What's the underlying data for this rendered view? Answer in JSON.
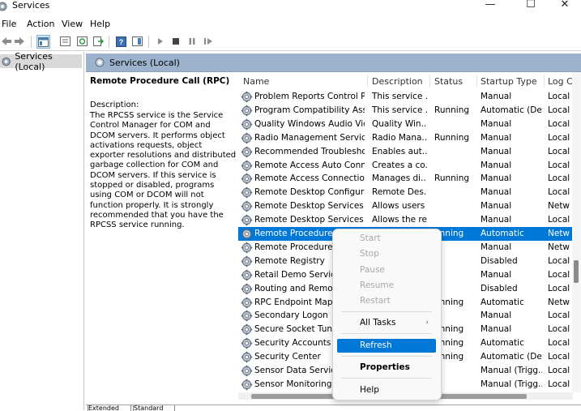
{
  "window": {
    "title": "Services",
    "minimize_glyph": "—",
    "maximize_glyph": "☐",
    "close_glyph": "✕"
  },
  "menu": [
    "File",
    "Action",
    "View",
    "Help"
  ],
  "tree": {
    "root": "Services (Local)"
  },
  "panel": {
    "header": "Services (Local)"
  },
  "details": {
    "title": "Remote Procedure Call (RPC)",
    "desc_label": "Description:",
    "description": "The RPCSS service is the Service Control Manager for COM and DCOM servers. It performs object activations requests, object exporter resolutions and distributed garbage collection for COM and DCOM servers. If this service is stopped or disabled, programs using COM or DCOM will not function properly. It is strongly recommended that you have the RPCSS service running."
  },
  "columns": [
    "Name",
    "Description",
    "Status",
    "Startup Type",
    "Log C"
  ],
  "rows": [
    {
      "name": "Problem Reports Control Pa...",
      "desc": "This service ...",
      "status": "",
      "startup": "Manual",
      "log": "Local"
    },
    {
      "name": "Program Compatibility Assis...",
      "desc": "This service ...",
      "status": "Running",
      "startup": "Automatic (De...",
      "log": "Local"
    },
    {
      "name": "Quality Windows Audio Vid...",
      "desc": "Quality Win...",
      "status": "",
      "startup": "Manual",
      "log": "Local"
    },
    {
      "name": "Radio Management Service",
      "desc": "Radio Mana...",
      "status": "Running",
      "startup": "Manual",
      "log": "Local"
    },
    {
      "name": "Recommended Troubleshoo...",
      "desc": "Enables aut...",
      "status": "",
      "startup": "Manual",
      "log": "Local"
    },
    {
      "name": "Remote Access Auto Connec...",
      "desc": "Creates a co...",
      "status": "",
      "startup": "Manual",
      "log": "Local"
    },
    {
      "name": "Remote Access Connection ...",
      "desc": "Manages di...",
      "status": "Running",
      "startup": "Manual",
      "log": "Local"
    },
    {
      "name": "Remote Desktop Configurati...",
      "desc": "Remote Des...",
      "status": "",
      "startup": "Manual",
      "log": "Local"
    },
    {
      "name": "Remote Desktop Services",
      "desc": "Allows users ...",
      "status": "",
      "startup": "Manual",
      "log": "Netw"
    },
    {
      "name": "Remote Desktop Services Us...",
      "desc": "Allows the re...",
      "status": "",
      "startup": "Manual",
      "log": "Local"
    },
    {
      "name": "Remote Procedure Ca",
      "desc": "",
      "status": "unning",
      "startup": "Automatic",
      "log": "Netw",
      "selected": true
    },
    {
      "name": "Remote Procedure Ca",
      "desc": "",
      "status": "",
      "startup": "Manual",
      "log": "Netw"
    },
    {
      "name": "Remote Registry",
      "desc": "",
      "status": "",
      "startup": "Disabled",
      "log": "Local"
    },
    {
      "name": "Retail Demo Service",
      "desc": "",
      "status": "",
      "startup": "Manual",
      "log": "Local"
    },
    {
      "name": "Routing and Remote",
      "desc": "",
      "status": "",
      "startup": "Disabled",
      "log": "Local"
    },
    {
      "name": "RPC Endpoint Mappe",
      "desc": "",
      "status": "unning",
      "startup": "Automatic",
      "log": "Netw"
    },
    {
      "name": "Secondary Logon",
      "desc": "",
      "status": "",
      "startup": "Manual",
      "log": "Local"
    },
    {
      "name": "Secure Socket Tunne",
      "desc": "",
      "status": "unning",
      "startup": "Manual",
      "log": "Local"
    },
    {
      "name": "Security Accounts Ma",
      "desc": "",
      "status": "unning",
      "startup": "Automatic",
      "log": "Local"
    },
    {
      "name": "Security Center",
      "desc": "",
      "status": "unning",
      "startup": "Automatic (De...",
      "log": "Local"
    },
    {
      "name": "Sensor Data Service",
      "desc": "",
      "status": "",
      "startup": "Manual (Trigg...",
      "log": "Local"
    },
    {
      "name": "Sensor Monitoring S",
      "desc": "",
      "status": "",
      "startup": "Manual (Trigg...",
      "log": "Local"
    }
  ],
  "context_menu": {
    "start": "Start",
    "stop": "Stop",
    "pause": "Pause",
    "resume": "Resume",
    "restart": "Restart",
    "all_tasks": "All Tasks",
    "all_tasks_arrow": "›",
    "refresh": "Refresh",
    "properties": "Properties",
    "help": "Help"
  },
  "tabs": [
    "Extended",
    "Standard"
  ],
  "colors": {
    "selection": "#0078d7",
    "panel_header": "#9db3cd",
    "tree_selected": "#d9d9d9"
  },
  "icons": {
    "app": "services-gear-icon",
    "toolbar": [
      "back-arrow-icon",
      "forward-arrow-icon",
      "console-tree-icon",
      "properties-sheet-icon",
      "refresh-icon",
      "export-list-icon",
      "help-icon",
      "action-pane-icon",
      "start-service-icon",
      "stop-service-icon",
      "pause-service-icon",
      "restart-service-icon"
    ]
  }
}
